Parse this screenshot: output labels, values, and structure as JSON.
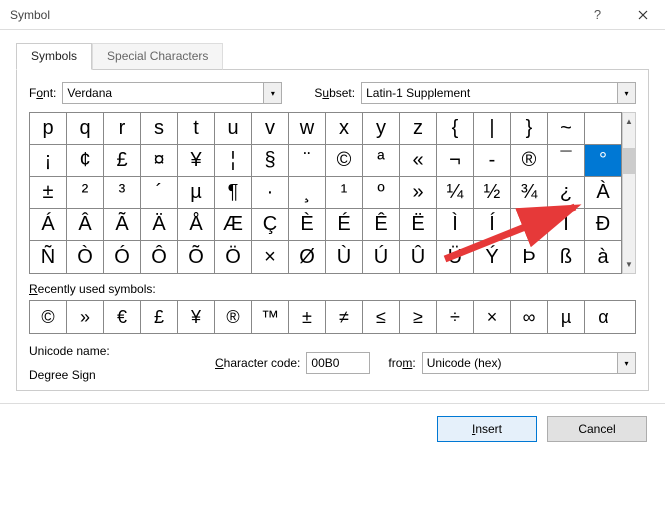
{
  "title": "Symbol",
  "tabs": {
    "symbols": "Symbols",
    "special": "Special Characters"
  },
  "font": {
    "label_pre": "F",
    "label_u": "o",
    "label_post": "nt:",
    "value": "Verdana"
  },
  "subset": {
    "label_pre": "S",
    "label_u": "u",
    "label_post": "bset:",
    "value": "Latin-1 Supplement"
  },
  "grid": [
    [
      "p",
      "q",
      "r",
      "s",
      "t",
      "u",
      "v",
      "w",
      "x",
      "y",
      "z",
      "{",
      "|",
      "}",
      "~",
      ""
    ],
    [
      "¡",
      "¢",
      "£",
      "¤",
      "¥",
      "¦",
      "§",
      "¨",
      "©",
      "ª",
      "«",
      "¬",
      "-",
      "®",
      "¯",
      "°"
    ],
    [
      "±",
      "²",
      "³",
      "´",
      "µ",
      "¶",
      "·",
      "¸",
      "¹",
      "º",
      "»",
      "¼",
      "½",
      "¾",
      "¿",
      "À"
    ],
    [
      "Á",
      "Â",
      "Ã",
      "Ä",
      "Å",
      "Æ",
      "Ç",
      "È",
      "É",
      "Ê",
      "Ë",
      "Ì",
      "Í",
      "Î",
      "Ï",
      "Ð"
    ],
    [
      "Ñ",
      "Ò",
      "Ó",
      "Ô",
      "Õ",
      "Ö",
      "×",
      "Ø",
      "Ù",
      "Ú",
      "Û",
      "Ü",
      "Ý",
      "Þ",
      "ß",
      "à"
    ]
  ],
  "selected": {
    "row": 1,
    "col": 15
  },
  "recent": {
    "label_pre": "",
    "label_u": "R",
    "label_post": "ecently used symbols:",
    "items": [
      "©",
      "»",
      "€",
      "£",
      "¥",
      "®",
      "™",
      "±",
      "≠",
      "≤",
      "≥",
      "÷",
      "×",
      "∞",
      "µ",
      "α"
    ]
  },
  "unicode": {
    "label": "Unicode name:",
    "value": "Degree Sign"
  },
  "charcode": {
    "label_u": "C",
    "label_post": "haracter code:",
    "value": "00B0"
  },
  "from": {
    "label_pre": "fro",
    "label_u": "m",
    "label_post": ":",
    "value": "Unicode (hex)"
  },
  "buttons": {
    "insert_u": "I",
    "insert_post": "nsert",
    "cancel": "Cancel"
  }
}
